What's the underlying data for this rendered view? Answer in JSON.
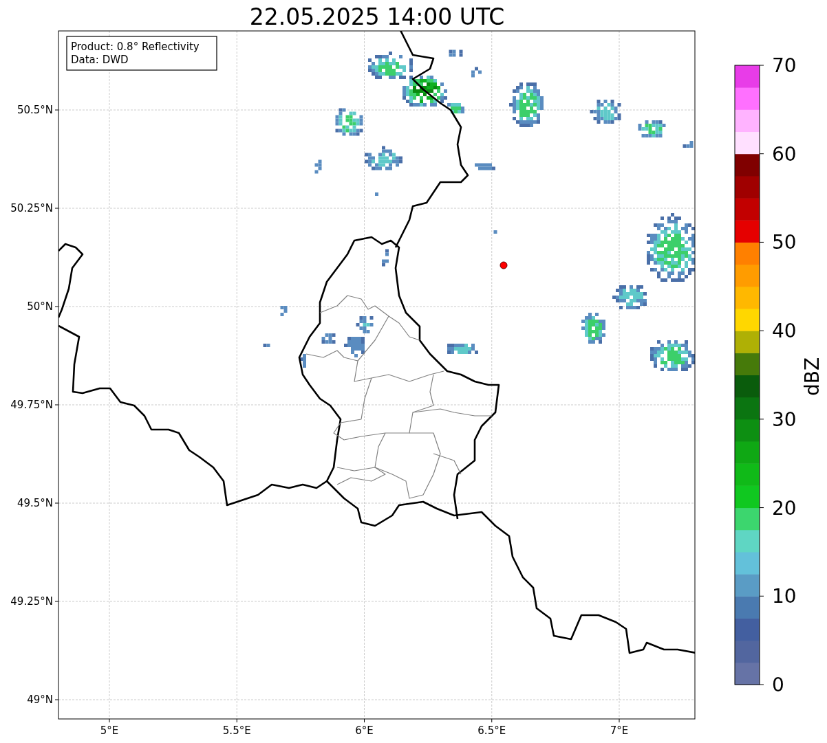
{
  "title": "22.05.2025 14:00 UTC",
  "info_box": {
    "lines": [
      "Product: 0.8° Reflectivity",
      "Data: DWD"
    ]
  },
  "map": {
    "x_ticks": [
      "5°E",
      "5.5°E",
      "6°E",
      "6.5°E",
      "7°E"
    ],
    "y_ticks": [
      "50.5°N",
      "50.25°N",
      "50°N",
      "49.75°N",
      "49.5°N",
      "49.25°N",
      "49°N"
    ]
  },
  "colorbar": {
    "label": "dBZ",
    "ticks": [
      "70",
      "60",
      "50",
      "40",
      "30",
      "20",
      "10",
      "0"
    ],
    "bands": [
      {
        "color": "#6673a6"
      },
      {
        "color": "#52669f"
      },
      {
        "color": "#435fa0"
      },
      {
        "color": "#4a7ab0"
      },
      {
        "color": "#5a9cc5"
      },
      {
        "color": "#63c1da"
      },
      {
        "color": "#5fd6c3"
      },
      {
        "color": "#3cd66e"
      },
      {
        "color": "#10c820"
      },
      {
        "color": "#10ba18"
      },
      {
        "color": "#0fa814"
      },
      {
        "color": "#0d8f12"
      },
      {
        "color": "#0b7511"
      },
      {
        "color": "#0a5c0c"
      },
      {
        "color": "#467a0a"
      },
      {
        "color": "#afb005"
      },
      {
        "color": "#ffd700"
      },
      {
        "color": "#ffb800"
      },
      {
        "color": "#ff9c00"
      },
      {
        "color": "#ff8000"
      },
      {
        "color": "#e50000"
      },
      {
        "color": "#c20000"
      },
      {
        "color": "#a00000"
      },
      {
        "color": "#800000"
      },
      {
        "color": "#ffe0ff"
      },
      {
        "color": "#ffb3ff"
      },
      {
        "color": "#ff70ff"
      },
      {
        "color": "#e83ce8"
      }
    ]
  }
}
